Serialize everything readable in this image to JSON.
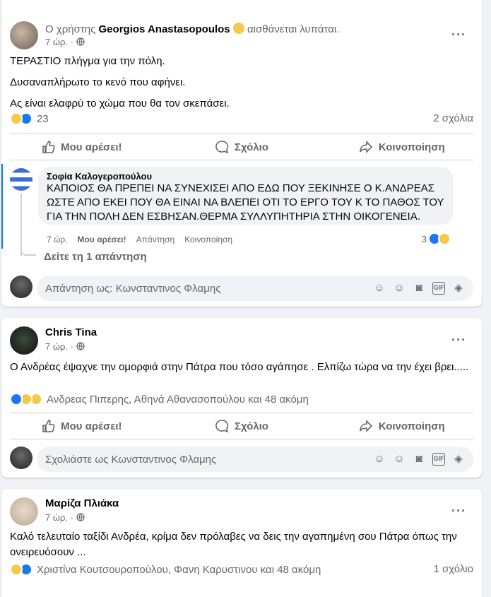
{
  "post1": {
    "prefix": "Ο χρήστης",
    "author": "Georgios Anastasopoulos",
    "feeling": "αισθάνεται λυπάται.",
    "time": "7 ώρ. ·",
    "lines": [
      "ΤΕΡΑΣΤΙΟ πλήγμα για την πόλη.",
      "Δυσαναπλήρωτο το κενό που αφήνει.",
      "Ας είναι ελαφρύ το χώμα που θα τον σκεπάσει."
    ],
    "reaction_count": "23",
    "comments_count": "2 σχόλια",
    "like_label": "Μου αρέσει!",
    "comment_label": "Σχόλιο",
    "share_label": "Κοινοποίηση",
    "comment": {
      "author": "Σοφία Καλογεροπούλου",
      "text": "ΚΑΠΟΙΟΣ ΘΑ ΠΡΕΠΕΙ ΝΑ ΣΥΝΕΧΙΣΕΙ ΑΠΟ ΕΔΩ ΠΟΥ ΞΕΚΙΝΗΣΕ Ο Κ.ΑΝΔΡΕΑΣ ΩΣΤΕ ΑΠΟ ΕΚΕΙ ΠΟΥ ΘΑ ΕΙΝΑΙ ΝΑ ΒΛΕΠΕΙ ΟΤΙ ΤΟ ΕΡΓΟ ΤΟΥ Κ ΤΟ ΠΑΘΟΣ ΤΟΥ ΓΙΑ ΤΗΝ ΠΟΛΗ ΔΕΝ ΕΣΒΗΣΑΝ.ΘΕΡΜΑ ΣΥΛΛΥΠΗΤΗΡΙΑ ΣΤΗΝ ΟΙΚΟΓΕΝΕΙΑ.",
      "time": "7 ώρ.",
      "like": "Μου αρέσει!",
      "reply": "Απάντηση",
      "share": "Κοινοποίηση",
      "reactions": "3",
      "see_reply": "Δείτε τη 1 απάντηση"
    },
    "reply_placeholder": "Απάντηση ως: Κωνσταντινος Φλαμης"
  },
  "post2": {
    "author": "Chris Tina",
    "time": "7 ώρ. ·",
    "text": "Ο Ανδρέας έψαχνε την ομορφιά στην Πάτρα που τόσο αγάπησε . Ελπίζω τώρα να την έχει βρει.....",
    "reactors": "Ανδρεας Πιπερης, Αθηνά Αθανασοπούλου και 48 ακόμη",
    "like_label": "Μου αρέσει!",
    "comment_label": "Σχόλιο",
    "share_label": "Κοινοποίηση",
    "comment_placeholder": "Σχολιάστε ως Κωνσταντινος Φλαμης"
  },
  "post3": {
    "author": "Μαρίζα Πλιάκα",
    "time": "7 ώρ. ·",
    "text": "Καλό τελευταίο ταξίδι Ανδρέα, κρίμα δεν πρόλαβες να δεις την αγαπημένη σου Πάτρα όπως την ονειρευόσουν ...",
    "reactors": "Χριστίνα Κουτσουροπούλου, Φανη Καρυστινου και 48 ακόμη",
    "comments_count": "1 σχόλιο"
  },
  "icons": {
    "privacy": "globe-icon",
    "more": "more-options-icon"
  },
  "colors": {
    "accent": "#1877f2",
    "muted": "#65676b",
    "comment_bar": "#1877f2"
  }
}
